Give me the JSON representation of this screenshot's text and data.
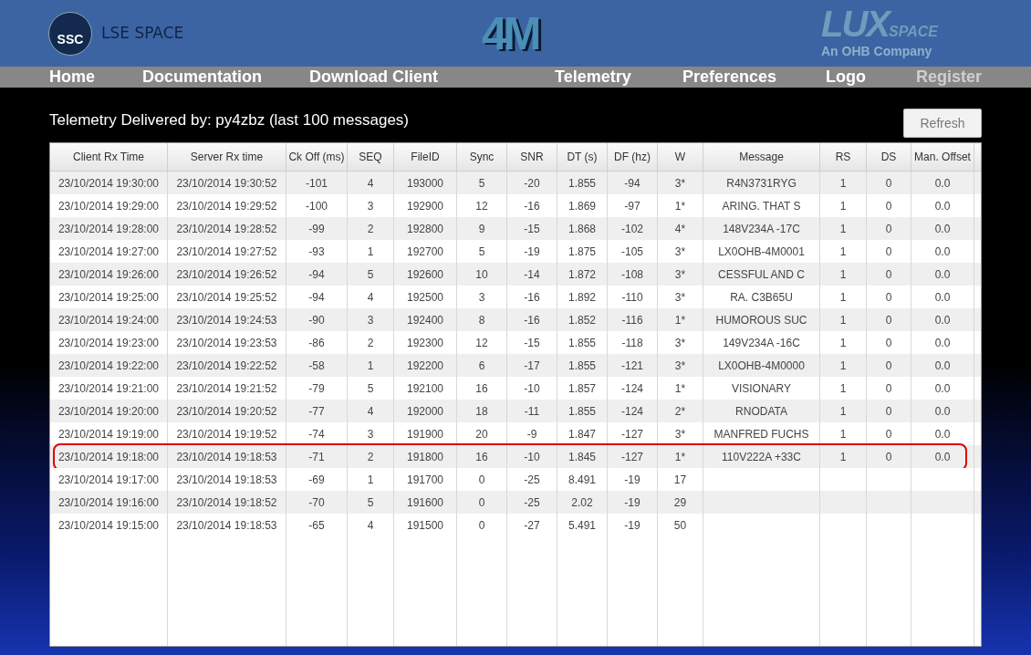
{
  "header": {
    "left_logo": {
      "badge": "SSC",
      "name": "LSE SPACE"
    },
    "center_logo": "4M",
    "right_logo": {
      "name": "LUX",
      "suffix": "SPACE",
      "tagline": "An OHB Company"
    }
  },
  "nav": [
    {
      "label": "Home",
      "disabled": false
    },
    {
      "label": "Documentation",
      "disabled": false
    },
    {
      "label": "Download Client",
      "disabled": false
    },
    {
      "label": "Telemetry",
      "disabled": false
    },
    {
      "label": "Preferences",
      "disabled": false
    },
    {
      "label": "Logo",
      "disabled": false
    },
    {
      "label": "Register",
      "disabled": true
    }
  ],
  "title": "Telemetry Delivered by: py4zbz (last 100 messages)",
  "refresh_button": "Refresh",
  "table": {
    "columns": [
      "Client Rx Time",
      "Server Rx time",
      "Ck Off (ms)",
      "SEQ",
      "FileID",
      "Sync",
      "SNR",
      "DT (s)",
      "DF (hz)",
      "W",
      "Message",
      "RS",
      "DS",
      "Man. Offset"
    ],
    "rows": [
      {
        "highlighted": false,
        "cells": [
          "23/10/2014 19:30:00",
          "23/10/2014 19:30:52",
          "-101",
          "4",
          "193000",
          "5",
          "-20",
          "1.855",
          "-94",
          "3*",
          "R4N3731RYG",
          "1",
          "0",
          "0.0"
        ]
      },
      {
        "highlighted": false,
        "cells": [
          "23/10/2014 19:29:00",
          "23/10/2014 19:29:52",
          "-100",
          "3",
          "192900",
          "12",
          "-16",
          "1.869",
          "-97",
          "1*",
          "ARING. THAT S",
          "1",
          "0",
          "0.0"
        ]
      },
      {
        "highlighted": false,
        "cells": [
          "23/10/2014 19:28:00",
          "23/10/2014 19:28:52",
          "-99",
          "2",
          "192800",
          "9",
          "-15",
          "1.868",
          "-102",
          "4*",
          "148V234A -17C",
          "1",
          "0",
          "0.0"
        ]
      },
      {
        "highlighted": false,
        "cells": [
          "23/10/2014 19:27:00",
          "23/10/2014 19:27:52",
          "-93",
          "1",
          "192700",
          "5",
          "-19",
          "1.875",
          "-105",
          "3*",
          "LX0OHB-4M0001",
          "1",
          "0",
          "0.0"
        ]
      },
      {
        "highlighted": false,
        "cells": [
          "23/10/2014 19:26:00",
          "23/10/2014 19:26:52",
          "-94",
          "5",
          "192600",
          "10",
          "-14",
          "1.872",
          "-108",
          "3*",
          "CESSFUL AND C",
          "1",
          "0",
          "0.0"
        ]
      },
      {
        "highlighted": false,
        "cells": [
          "23/10/2014 19:25:00",
          "23/10/2014 19:25:52",
          "-94",
          "4",
          "192500",
          "3",
          "-16",
          "1.892",
          "-110",
          "3*",
          "RA. C3B65U",
          "1",
          "0",
          "0.0"
        ]
      },
      {
        "highlighted": false,
        "cells": [
          "23/10/2014 19:24:00",
          "23/10/2014 19:24:53",
          "-90",
          "3",
          "192400",
          "8",
          "-16",
          "1.852",
          "-116",
          "1*",
          "HUMOROUS  SUC",
          "1",
          "0",
          "0.0"
        ]
      },
      {
        "highlighted": false,
        "cells": [
          "23/10/2014 19:23:00",
          "23/10/2014 19:23:53",
          "-86",
          "2",
          "192300",
          "12",
          "-15",
          "1.855",
          "-118",
          "3*",
          "149V234A -16C",
          "1",
          "0",
          "0.0"
        ]
      },
      {
        "highlighted": false,
        "cells": [
          "23/10/2014 19:22:00",
          "23/10/2014 19:22:52",
          "-58",
          "1",
          "192200",
          "6",
          "-17",
          "1.855",
          "-121",
          "3*",
          "LX0OHB-4M0000",
          "1",
          "0",
          "0.0"
        ]
      },
      {
        "highlighted": false,
        "cells": [
          "23/10/2014 19:21:00",
          "23/10/2014 19:21:52",
          "-79",
          "5",
          "192100",
          "16",
          "-10",
          "1.857",
          "-124",
          "1*",
          "VISIONARY",
          "1",
          "0",
          "0.0"
        ]
      },
      {
        "highlighted": false,
        "cells": [
          "23/10/2014 19:20:00",
          "23/10/2014 19:20:52",
          "-77",
          "4",
          "192000",
          "18",
          "-11",
          "1.855",
          "-124",
          "2*",
          "RNODATA",
          "1",
          "0",
          "0.0"
        ]
      },
      {
        "highlighted": false,
        "cells": [
          "23/10/2014 19:19:00",
          "23/10/2014 19:19:52",
          "-74",
          "3",
          "191900",
          "20",
          "-9",
          "1.847",
          "-127",
          "3*",
          "MANFRED FUCHS",
          "1",
          "0",
          "0.0"
        ]
      },
      {
        "highlighted": true,
        "cells": [
          "23/10/2014 19:18:00",
          "23/10/2014 19:18:53",
          "-71",
          "2",
          "191800",
          "16",
          "-10",
          "1.845",
          "-127",
          "1*",
          "110V222A +33C",
          "1",
          "0",
          "0.0"
        ]
      },
      {
        "highlighted": false,
        "cells": [
          "23/10/2014 19:17:00",
          "23/10/2014 19:18:53",
          "-69",
          "1",
          "191700",
          "0",
          "-25",
          "8.491",
          "-19",
          "17"
        ]
      },
      {
        "highlighted": false,
        "cells": [
          "23/10/2014 19:16:00",
          "23/10/2014 19:18:52",
          "-70",
          "5",
          "191600",
          "0",
          "-25",
          "2.02",
          "-19",
          "29"
        ]
      },
      {
        "highlighted": false,
        "cells": [
          "23/10/2014 19:15:00",
          "23/10/2014 19:18:53",
          "-65",
          "4",
          "191500",
          "0",
          "-27",
          "5.491",
          "-19",
          "50"
        ]
      }
    ]
  }
}
